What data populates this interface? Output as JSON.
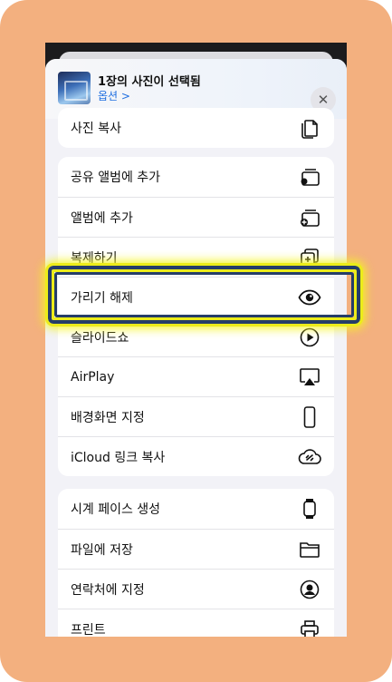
{
  "header": {
    "title": "1장의 사진이 선택됨",
    "options_label": "옵션 >",
    "close_glyph": "✕"
  },
  "groups": [
    {
      "items": [
        {
          "label": "사진 복사",
          "icon": "copy-icon"
        }
      ]
    },
    {
      "items": [
        {
          "label": "공유 앨범에 추가",
          "icon": "shared-album-add-icon"
        },
        {
          "label": "앨범에 추가",
          "icon": "album-add-icon"
        },
        {
          "label": "복제하기",
          "icon": "duplicate-icon"
        },
        {
          "label": "가리기 해제",
          "icon": "eye-icon"
        },
        {
          "label": "슬라이드쇼",
          "icon": "play-circle-icon"
        },
        {
          "label": "AirPlay",
          "icon": "airplay-icon"
        },
        {
          "label": "배경화면 지정",
          "icon": "phone-icon"
        },
        {
          "label": "iCloud 링크 복사",
          "icon": "cloud-link-icon"
        }
      ]
    },
    {
      "items": [
        {
          "label": "시계 페이스 생성",
          "icon": "watch-icon"
        },
        {
          "label": "파일에 저장",
          "icon": "folder-icon"
        },
        {
          "label": "연락처에 지정",
          "icon": "contact-icon"
        },
        {
          "label": "프린트",
          "icon": "printer-icon"
        }
      ]
    }
  ],
  "colors": {
    "accent": "#1f6fe0",
    "highlight_outer": "#ecec1a",
    "highlight_inner": "#253d68",
    "frame": "#f3b07f"
  }
}
